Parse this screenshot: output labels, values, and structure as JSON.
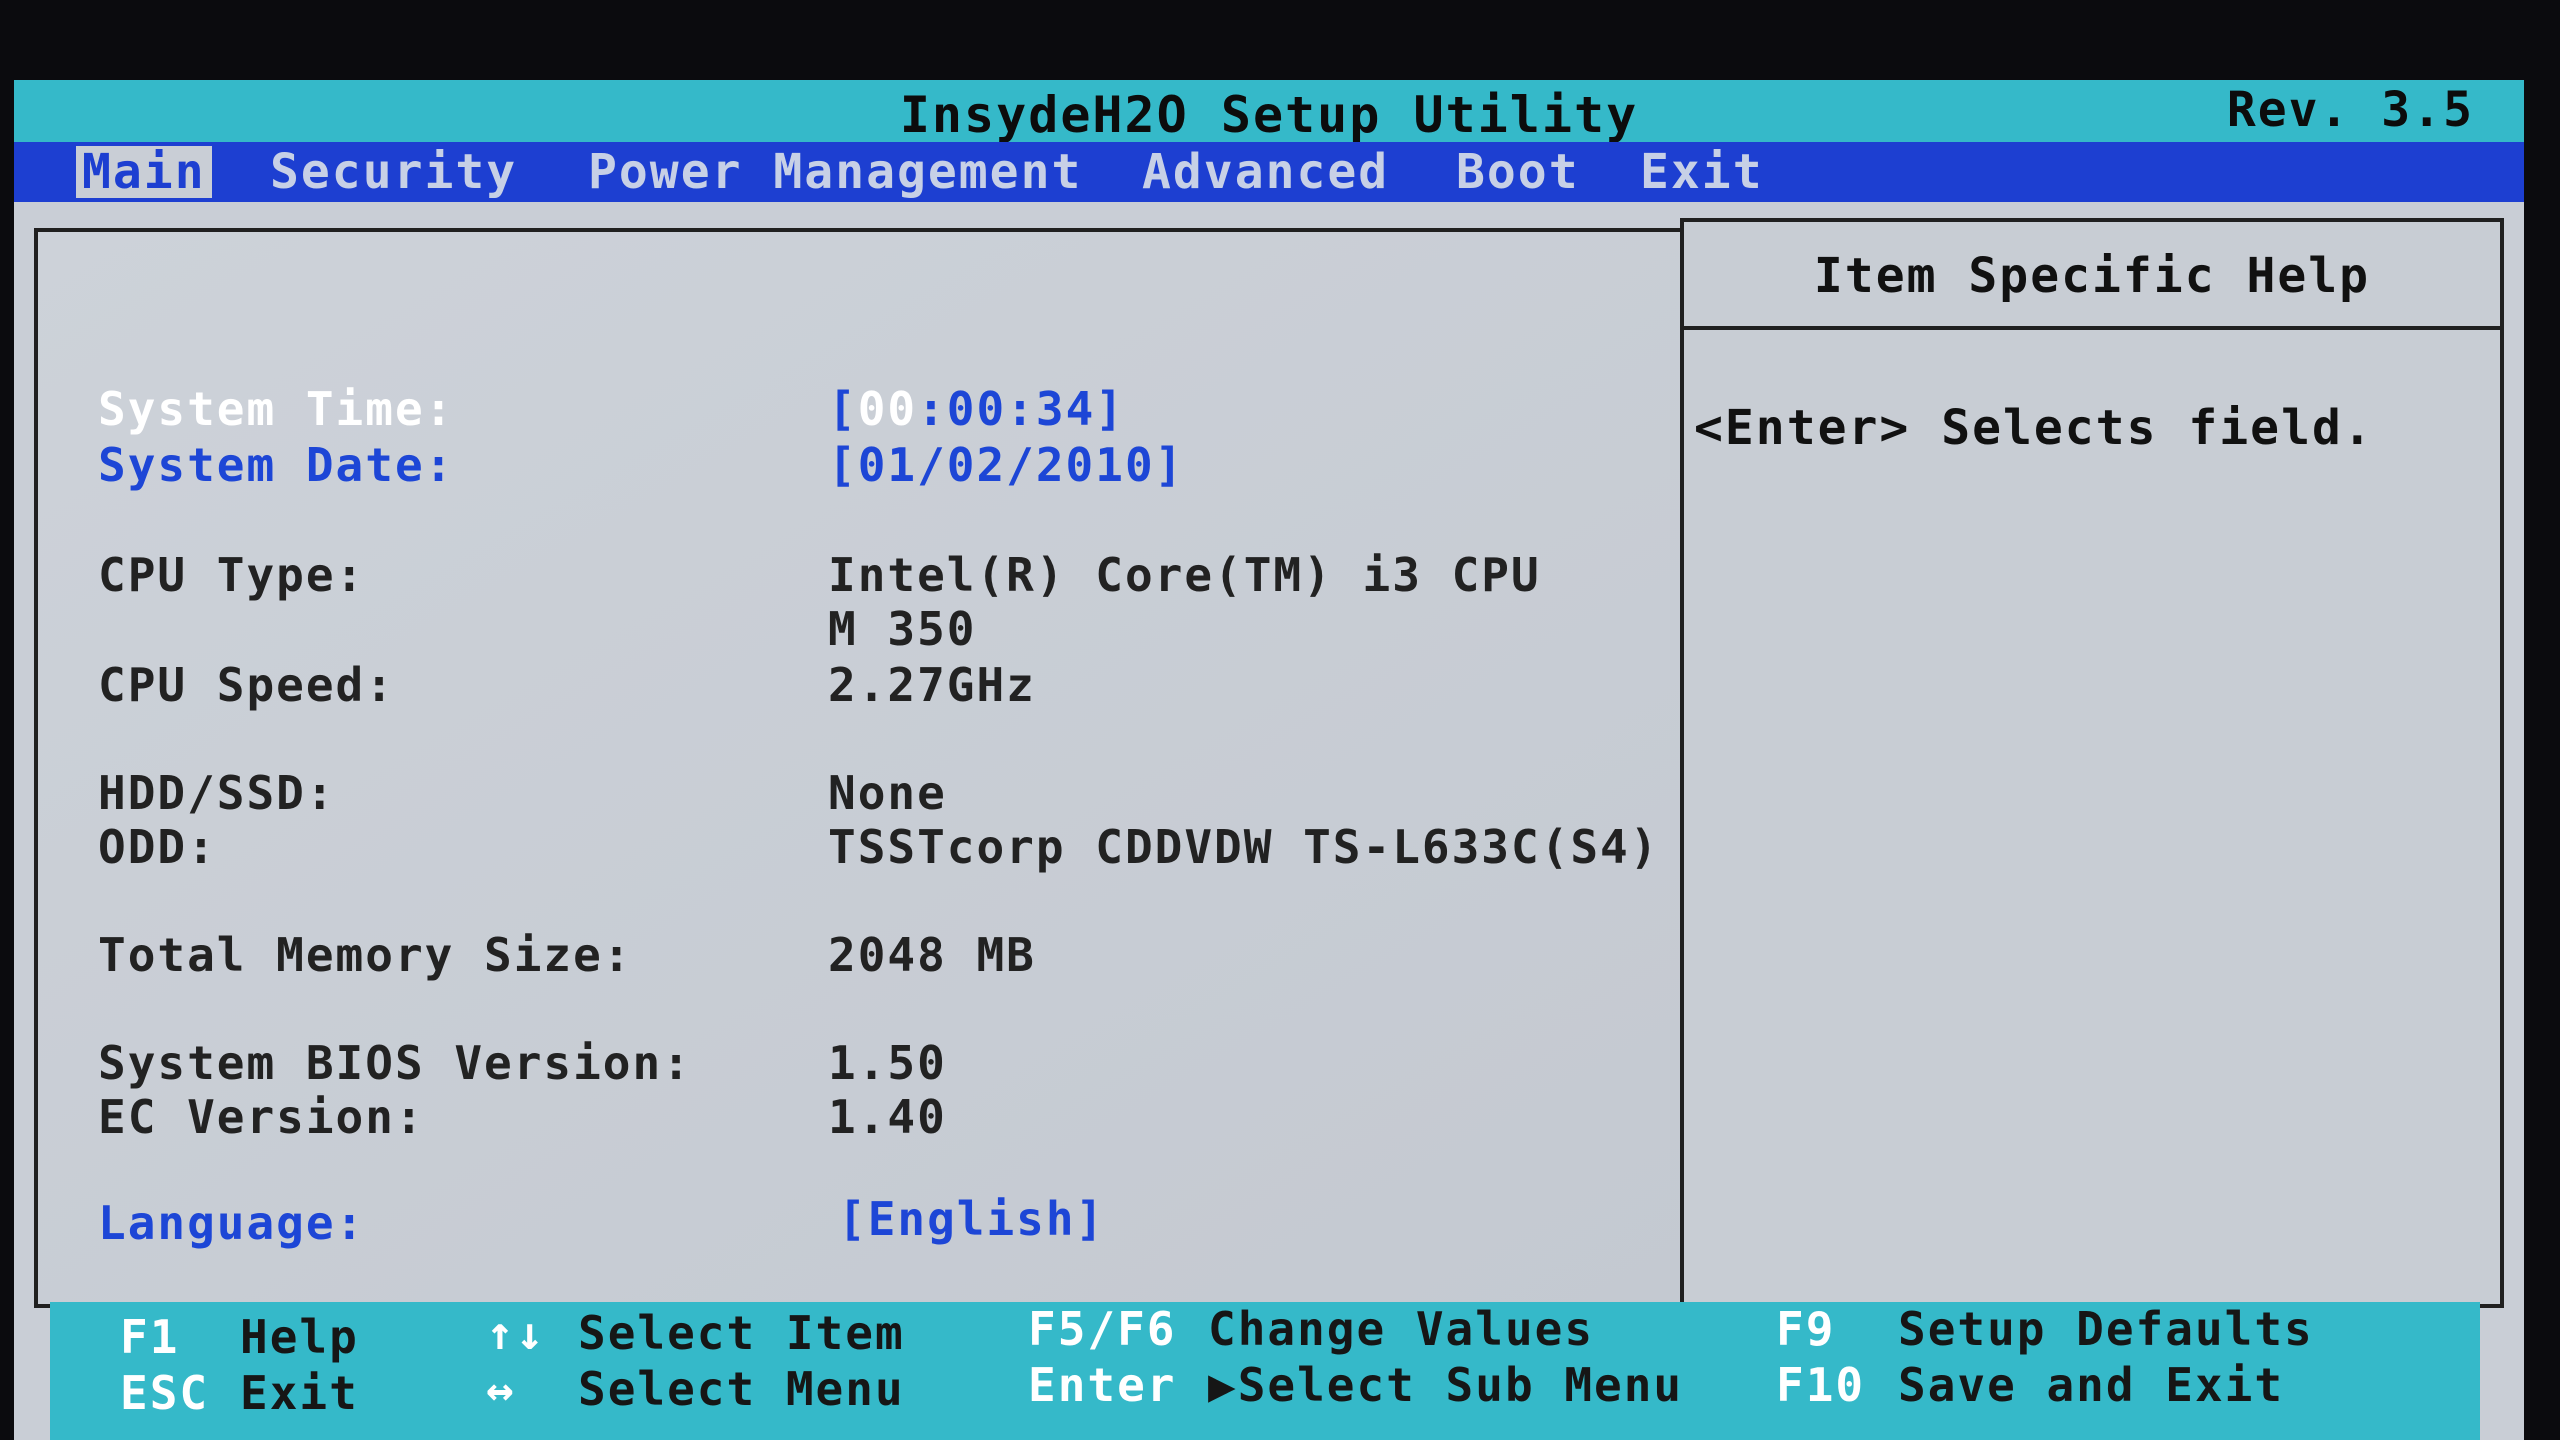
{
  "header": {
    "title": "InsydeH2O Setup Utility",
    "revision": "Rev. 3.5"
  },
  "menu": [
    "Main",
    "Security",
    "Power Management",
    "Advanced",
    "Boot",
    "Exit"
  ],
  "main": {
    "system_time": {
      "label": "System Time:",
      "open": "[",
      "highlight": "00",
      "rest": ":00:34]"
    },
    "system_date": {
      "label": "System Date:",
      "value": "[01/02/2010]"
    },
    "cpu_type": {
      "label": "CPU Type:",
      "value_line1": "Intel(R) Core(TM) i3 CPU",
      "value_line2": "M 350"
    },
    "cpu_speed": {
      "label": "CPU Speed:",
      "value": "2.27GHz"
    },
    "hdd": {
      "label": "HDD/SSD:",
      "value": "None"
    },
    "odd": {
      "label": "ODD:",
      "value": "TSSTcorp CDDVDW TS-L633C(S4)"
    },
    "memory": {
      "label": "Total Memory Size:",
      "value": "2048 MB"
    },
    "bios_version": {
      "label": "System BIOS Version:",
      "value": "1.50"
    },
    "ec_version": {
      "label": "EC Version:",
      "value": "1.40"
    },
    "language": {
      "label": "Language:",
      "value": "[English]"
    }
  },
  "help": {
    "title": "Item Specific Help",
    "text": "<Enter> Selects field."
  },
  "footer": {
    "f1_key": "F1",
    "f1_label": "Help",
    "esc_key": "ESC",
    "esc_label": "Exit",
    "updown_key": "↑↓",
    "updown_label": "Select Item",
    "leftright_key": "↔",
    "leftright_label": "Select Menu",
    "f5f6_key": "F5/F6",
    "f5f6_label": "Change Values",
    "enter_key": "Enter",
    "enter_label": "▶Select Sub Menu",
    "f9_key": "F9",
    "f9_label": "Setup Defaults",
    "f10_key": "F10",
    "f10_label": "Save and Exit"
  }
}
